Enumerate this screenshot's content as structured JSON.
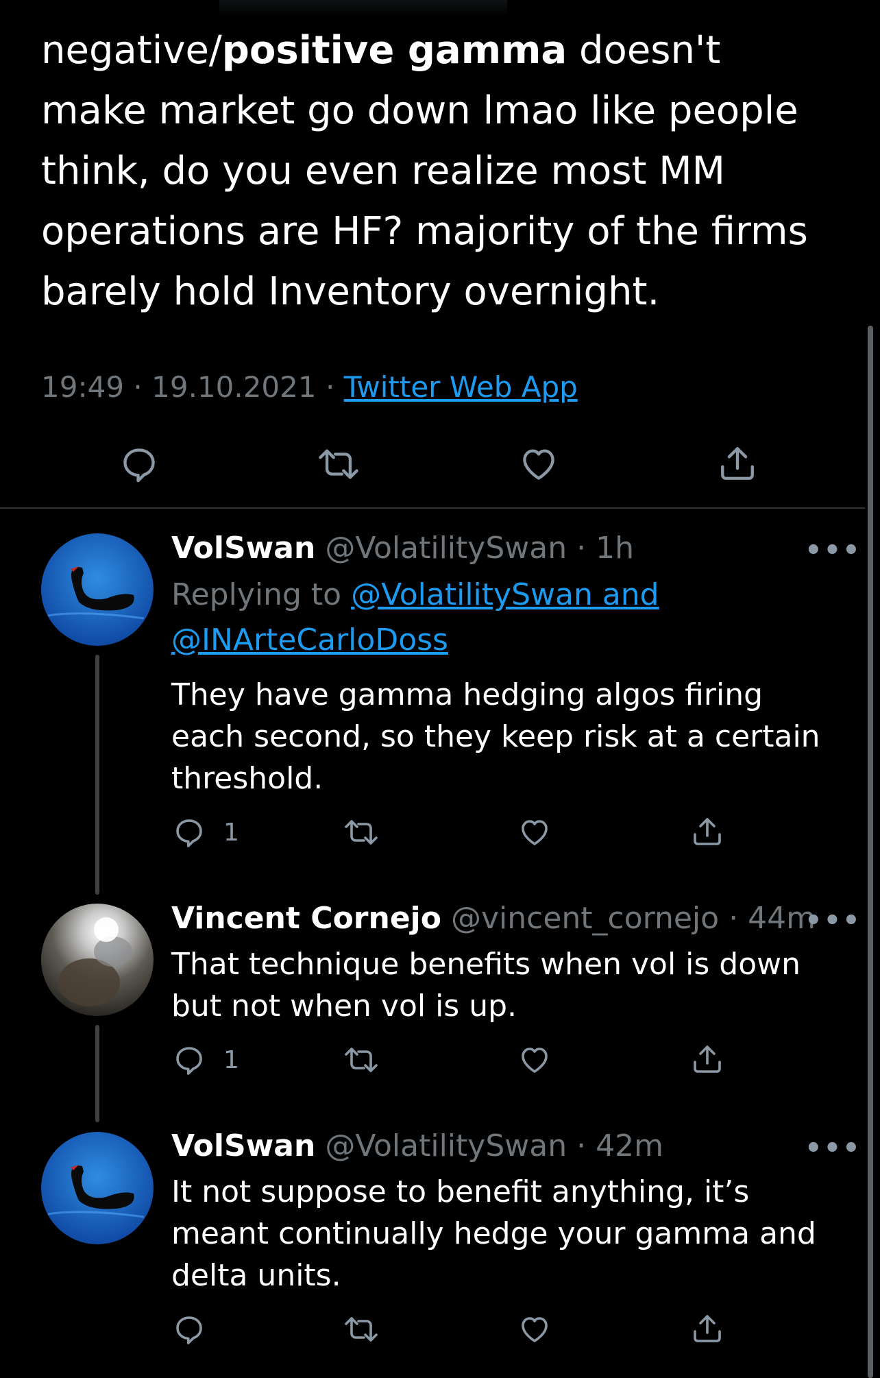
{
  "main_tweet": {
    "text_before_bold": "negative/",
    "text_bold": "positive gamma",
    "text_after_bold": " doesn't make market go down lmao like people think,  do you even realize most MM operations are HF? majority of the firms barely hold Inventory overnight.",
    "time": "19:49",
    "date": "19.10.2021",
    "separator": "·",
    "source": "Twitter Web App"
  },
  "replies": [
    {
      "display_name": "VolSwan",
      "handle": "@VolatilitySwan",
      "age": "1h",
      "replying_to_prefix": "Replying to",
      "replying_to_mentions": "@VolatilitySwan and @INArteCarloDoss",
      "text": "They have gamma hedging algos firing each second, so they keep risk at a certain threshold.",
      "reply_count": "1",
      "avatar": "black-swan-avatar"
    },
    {
      "display_name": "Vincent Cornejo",
      "handle": "@vincent_cornejo",
      "age": "44m",
      "text": "That technique benefits when vol is down but not when vol is up.",
      "reply_count": "1",
      "avatar": "person-avatar"
    },
    {
      "display_name": "VolSwan",
      "handle": "@VolatilitySwan",
      "age": "42m",
      "text": "It not suppose to benefit anything,  it’s meant continually hedge your gamma and delta units.",
      "reply_count": "",
      "avatar": "black-swan-avatar"
    }
  ],
  "icons": {
    "reply": "reply-icon",
    "retweet": "retweet-icon",
    "like": "like-icon",
    "share": "share-icon",
    "more": "more-icon"
  },
  "colors": {
    "background": "#000000",
    "text": "#ffffff",
    "muted": "#71767b",
    "link": "#1d9bf0",
    "divider": "#2f3336"
  }
}
